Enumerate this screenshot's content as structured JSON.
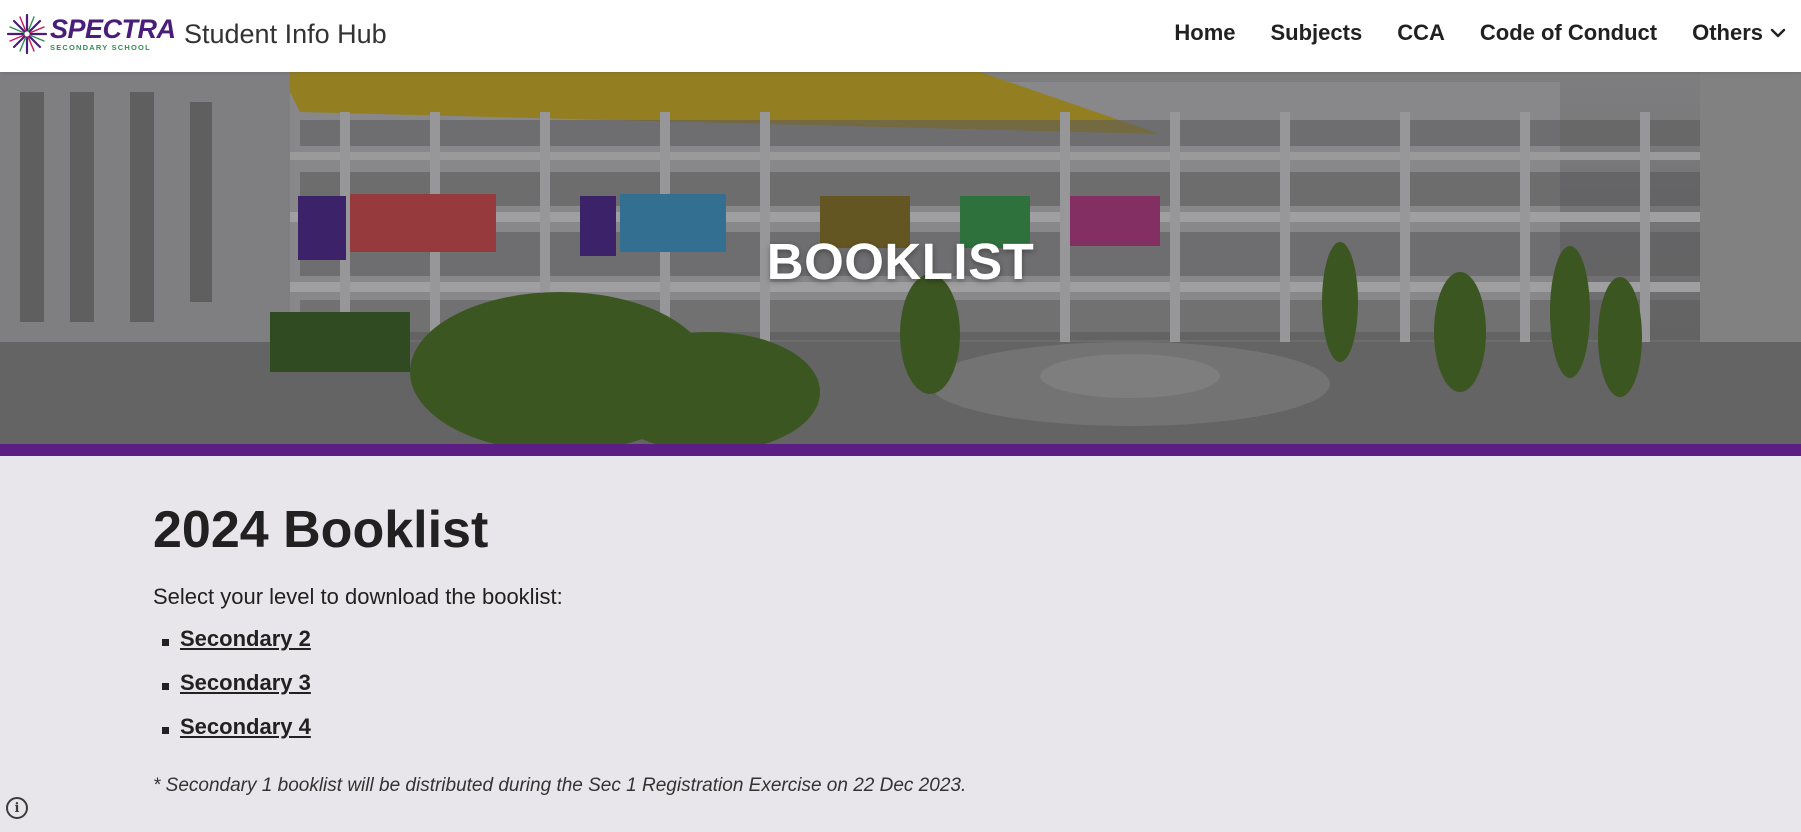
{
  "header": {
    "logo": {
      "word": "SPECTRA",
      "subtext": "SECONDARY SCHOOL"
    },
    "site_title": "Student Info Hub",
    "nav": [
      "Home",
      "Subjects",
      "CCA",
      "Code of Conduct",
      "Others"
    ]
  },
  "hero": {
    "title": "BOOKLIST"
  },
  "main": {
    "heading": "2024 Booklist",
    "intro": "Select your level to download the booklist:",
    "levels": [
      "Secondary 2",
      "Secondary 3",
      "Secondary 4"
    ],
    "note": "* Secondary 1 booklist will be distributed during the Sec 1 Registration Exercise on 22 Dec 2023."
  },
  "colors": {
    "accent": "#5b1f84",
    "page_background": "#e8e6ea",
    "logo_purple": "#4b1d7a",
    "logo_green": "#2f8f55"
  },
  "icons": {
    "others_dropdown": "chevron-down-icon",
    "info": "info-icon"
  }
}
